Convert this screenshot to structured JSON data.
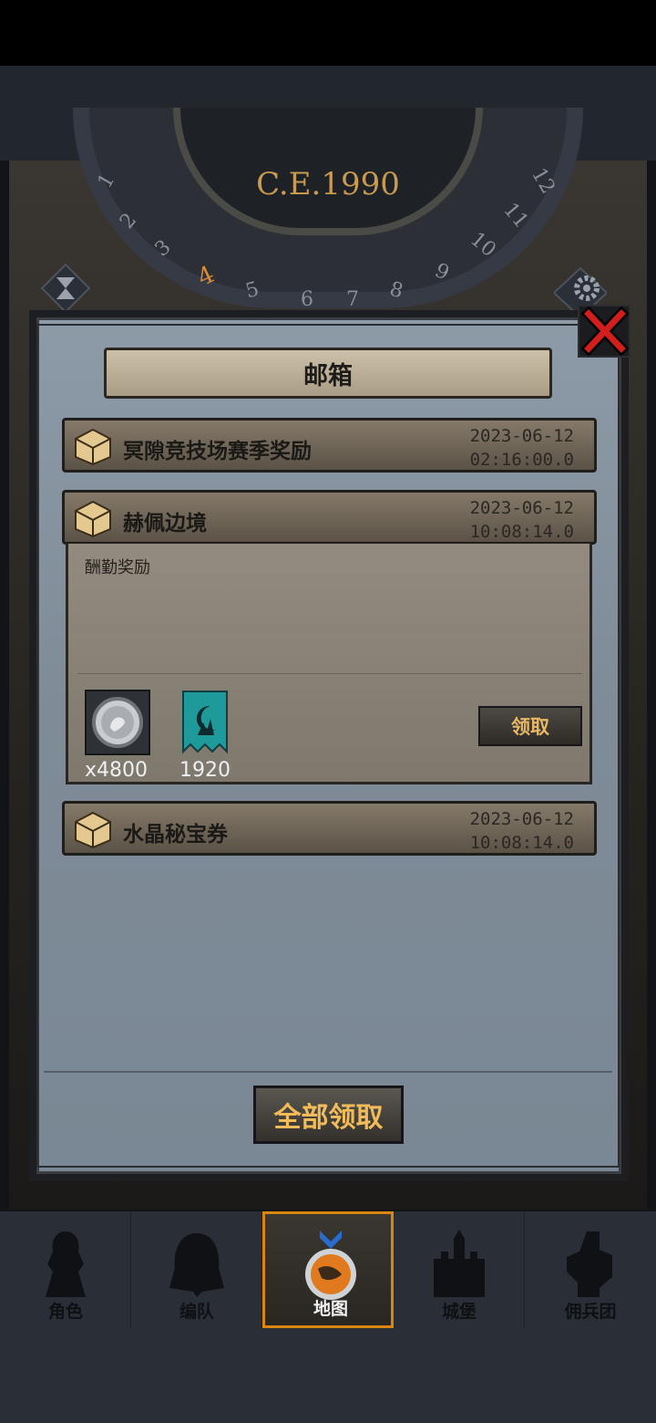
{
  "header": {
    "era": "C.E.1990"
  },
  "dial": {
    "numbers": [
      "1",
      "2",
      "3",
      "4",
      "5",
      "6",
      "7",
      "8",
      "9",
      "10",
      "11",
      "12"
    ],
    "current": "4"
  },
  "mailbox": {
    "title": "邮箱",
    "mails": [
      {
        "title": "冥隙竞技场赛季奖励",
        "date": "2023-06-12",
        "time": "02:16:00.0"
      },
      {
        "title": "赫佩边境",
        "date": "2023-06-12",
        "time": "10:08:14.0",
        "body": "酬勤奖励",
        "rewards": [
          {
            "icon": "silver-coin-icon",
            "quantity": "x4800"
          },
          {
            "icon": "moon-banner-icon",
            "quantity": "1920"
          }
        ],
        "claim_label": "领取"
      },
      {
        "title": "水晶秘宝券",
        "date": "2023-06-12",
        "time": "10:08:14.0"
      }
    ],
    "claim_all_label": "全部领取"
  },
  "nav": {
    "items": [
      {
        "label": "角色",
        "icon": "knight-icon"
      },
      {
        "label": "编队",
        "icon": "helmet-icon"
      },
      {
        "label": "地图",
        "icon": "globe-icon",
        "active": true
      },
      {
        "label": "城堡",
        "icon": "castle-icon"
      },
      {
        "label": "佣兵团",
        "icon": "fist-icon"
      }
    ]
  },
  "colors": {
    "accent": "#d9860f",
    "gold_text": "#f0bb58",
    "close_red": "#d31e1e",
    "panel": "#8794a0"
  }
}
